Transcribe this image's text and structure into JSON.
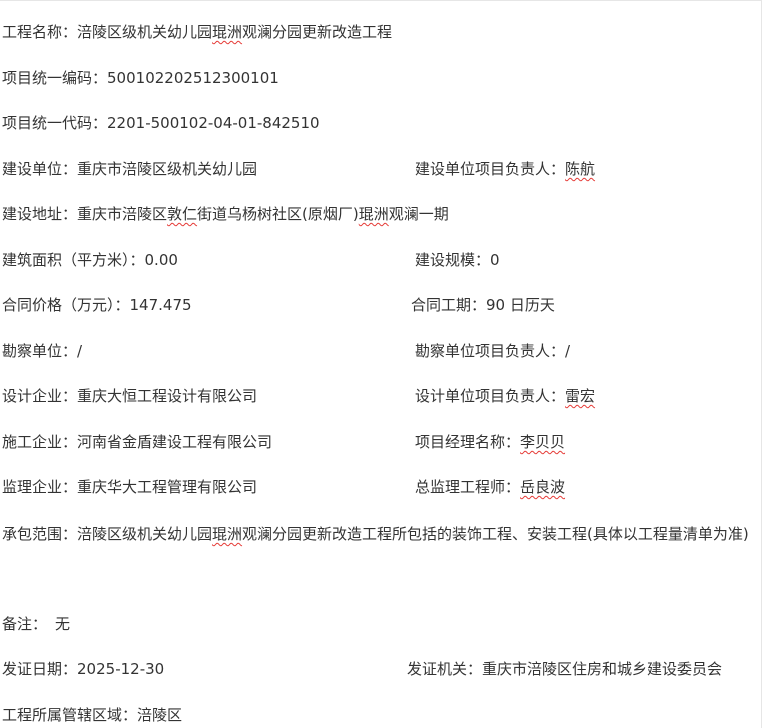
{
  "project_name": {
    "label": "工程名称：",
    "value_prefix": "涪陵区级机关幼儿园",
    "value_mark": "琨洲",
    "value_suffix": "观澜分园更新改造工程"
  },
  "project_code": {
    "label": "项目统一编码：",
    "value": "500102202512300101"
  },
  "project_code2": {
    "label": "项目统一代码：",
    "value": "2201-500102-04-01-842510"
  },
  "builder": {
    "label": "建设单位：",
    "value": "重庆市涪陵区级机关幼儿园",
    "lead_label": "建设单位项目负责人：",
    "lead_value": "陈航"
  },
  "address": {
    "label": "建设地址：",
    "value_a": "重庆市涪陵区",
    "value_mark1": "敦仁",
    "value_b": "街道乌杨树社区(原烟厂)",
    "value_mark2": "琨洲",
    "value_c": "观澜一期"
  },
  "area": {
    "label": "建筑面积（平方米）：",
    "value": "0.00",
    "scale_label": "建设规模：",
    "scale_value": "0"
  },
  "price": {
    "label": "合同价格（万元）：",
    "value": "147.475",
    "period_label": "合同工期：",
    "period_value": "90 日历天"
  },
  "survey": {
    "label": "勘察单位：",
    "value": "/",
    "lead_label": "勘察单位项目负责人：",
    "lead_value": "/"
  },
  "design": {
    "label": "设计企业：",
    "value": "重庆大恒工程设计有限公司",
    "lead_label": "设计单位项目负责人：",
    "lead_value": "雷宏"
  },
  "construction": {
    "label": "施工企业：",
    "value": "河南省金盾建设工程有限公司",
    "lead_label": "项目经理名称：",
    "lead_value": "李贝贝"
  },
  "supervision": {
    "label": "监理企业：",
    "value": "重庆华大工程管理有限公司",
    "lead_label": "总监理工程师：",
    "lead_value": "岳良波"
  },
  "scope": {
    "label": "承包范围：",
    "value_prefix": "涪陵区级机关幼儿园",
    "value_mark": "琨洲",
    "value_suffix": "观澜分园更新改造工程所包括的装饰工程、安装工程(具体以工程量清单为准)"
  },
  "remark": {
    "label": "备注：",
    "value": "无"
  },
  "issue": {
    "label": "发证日期：",
    "value": "2025-12-30",
    "authority_label": "发证机关：",
    "authority_value": "重庆市涪陵区住房和城乡建设委员会"
  },
  "jurisdiction": {
    "label": "工程所属管辖区域：",
    "value": "涪陵区"
  }
}
